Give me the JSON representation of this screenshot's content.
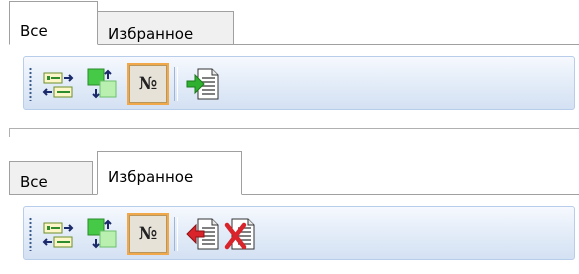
{
  "tabs": {
    "all_label": "Все",
    "favorites_label": "Избранное"
  },
  "panels": [
    {
      "active_tab": "all",
      "toolbar_buttons": [
        {
          "icon": "swap-fields-icon",
          "pressed": false
        },
        {
          "icon": "swap-blocks-icon",
          "pressed": false
        },
        {
          "icon": "numbering-icon",
          "pressed": true,
          "text": "№"
        },
        {
          "icon": "add-to-favorites-icon",
          "pressed": false
        }
      ]
    },
    {
      "active_tab": "favorites",
      "toolbar_buttons": [
        {
          "icon": "swap-fields-icon",
          "pressed": false
        },
        {
          "icon": "swap-blocks-icon",
          "pressed": false
        },
        {
          "icon": "numbering-icon",
          "pressed": true,
          "text": "№"
        },
        {
          "icon": "remove-from-favorites-icon",
          "pressed": false
        },
        {
          "icon": "delete-document-icon",
          "pressed": false
        }
      ]
    }
  ],
  "colors": {
    "toolbar_border": "#b8cde9",
    "pressed_border": "#f0a84a",
    "green_arrow": "#2fb12f",
    "red_arrow": "#d8242a"
  }
}
